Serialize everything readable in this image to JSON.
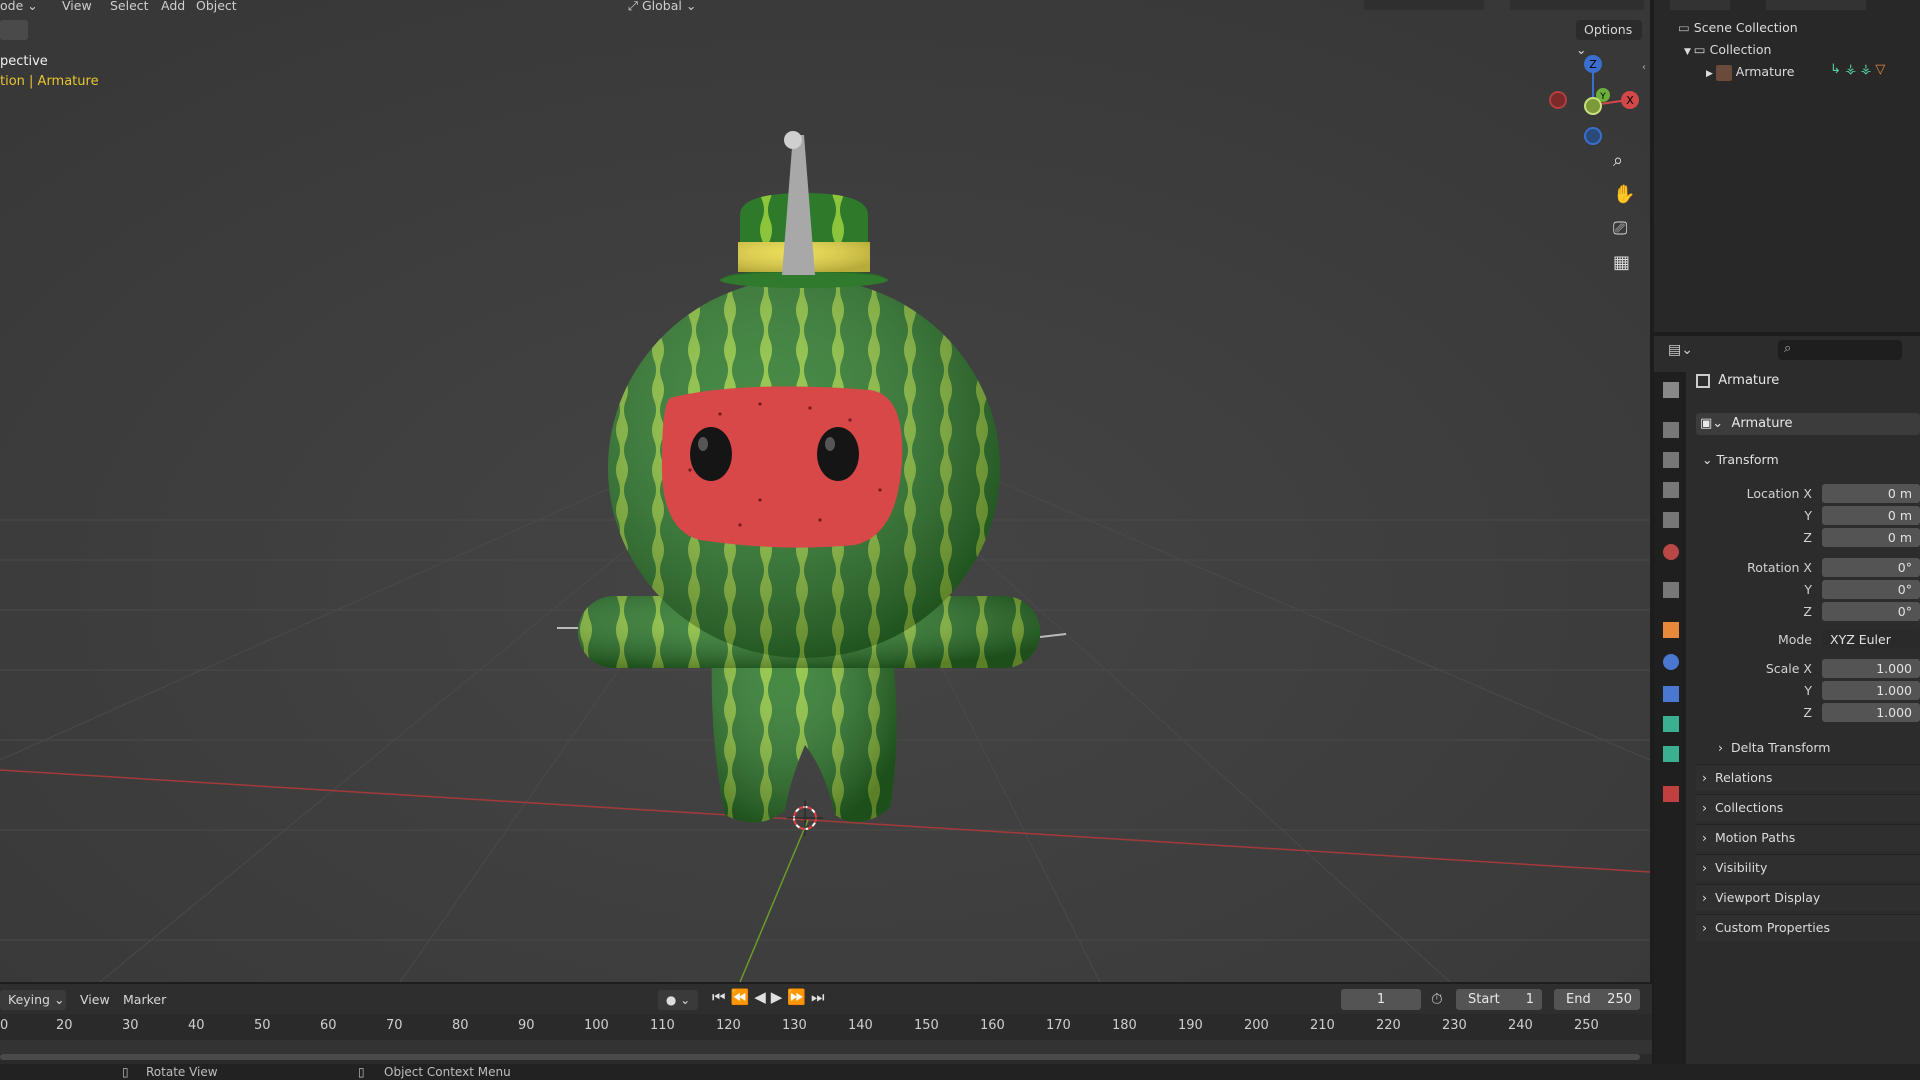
{
  "viewport_header": {
    "menu": [
      "ode",
      "View",
      "Select",
      "Add",
      "Object"
    ],
    "transform_orientation": "Global",
    "options_label": "Options"
  },
  "viewport_overlay": {
    "view_name": "pective",
    "context": "tion | Armature"
  },
  "gizmo": {
    "x": "X",
    "y": "Y",
    "z": "Z"
  },
  "outliner": {
    "scene_collection": "Scene Collection",
    "collection": "Collection",
    "object": "Armature"
  },
  "properties": {
    "object_name": "Armature",
    "datablock_name": "Armature",
    "transform_label": "Transform",
    "location": {
      "x_label": "Location X",
      "y_label": "Y",
      "z_label": "Z",
      "x": "0 m",
      "y": "0 m",
      "z": "0 m"
    },
    "rotation": {
      "x_label": "Rotation X",
      "y_label": "Y",
      "z_label": "Z",
      "x": "0°",
      "y": "0°",
      "z": "0°"
    },
    "mode": {
      "label": "Mode",
      "value": "XYZ Euler"
    },
    "scale": {
      "x_label": "Scale X",
      "y_label": "Y",
      "z_label": "Z",
      "x": "1.000",
      "y": "1.000",
      "z": "1.000"
    },
    "delta_transform": "Delta Transform",
    "panels": [
      "Relations",
      "Collections",
      "Motion Paths",
      "Visibility",
      "Viewport Display",
      "Custom Properties"
    ]
  },
  "timeline": {
    "keying": "Keying",
    "view": "View",
    "marker": "Marker",
    "current_frame": "1",
    "start_label": "Start",
    "start": "1",
    "end_label": "End",
    "end": "250",
    "ticks": [
      "0",
      "20",
      "30",
      "40",
      "50",
      "60",
      "70",
      "80",
      "90",
      "100",
      "110",
      "120",
      "130",
      "140",
      "150",
      "160",
      "170",
      "180",
      "190",
      "200",
      "210",
      "220",
      "230",
      "240",
      "250"
    ]
  },
  "statusbar": {
    "left": "Rotate View",
    "middle": "Object Context Menu"
  },
  "colors": {
    "viewport_bg": "#3d3d3d",
    "accent_orange": "#e8883a",
    "text_highlight": "#e8c530",
    "watermelon_green": "#2d7d2a",
    "watermelon_stripe": "#8cc43c",
    "face_red": "#d94848"
  }
}
